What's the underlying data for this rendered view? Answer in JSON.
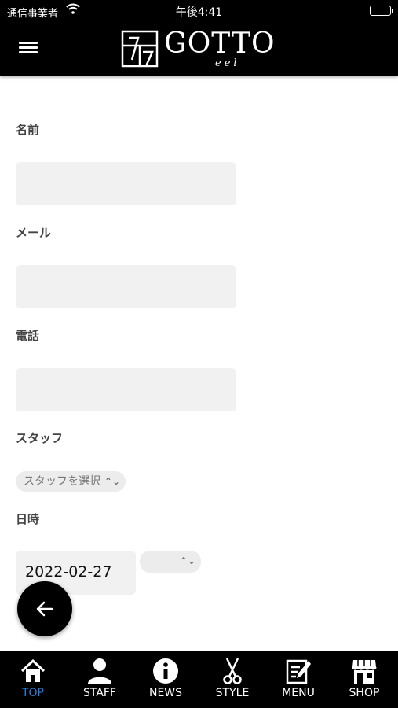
{
  "status_bar": {
    "carrier": "通信事業者",
    "time": "午後4:41"
  },
  "header": {
    "menu_icon": "hamburger-menu-icon",
    "logo_text": "GOTTO",
    "logo_sub": "eel"
  },
  "form": {
    "name_label": "名前",
    "email_label": "メール",
    "phone_label": "電話",
    "staff_label": "スタッフ",
    "staff_select_value": "スタッフを選択",
    "datetime_label": "日時",
    "date_value": "2022-02-27",
    "time_select_value": ""
  },
  "fab": {
    "icon": "arrow-left-icon"
  },
  "tab_bar": {
    "active_color": "#2f7bd9",
    "items": [
      {
        "label": "TOP",
        "icon": "home-icon"
      },
      {
        "label": "STAFF",
        "icon": "person-icon"
      },
      {
        "label": "NEWS",
        "icon": "info-icon"
      },
      {
        "label": "STYLE",
        "icon": "scissors-icon"
      },
      {
        "label": "MENU",
        "icon": "edit-list-icon"
      },
      {
        "label": "SHOP",
        "icon": "storefront-icon"
      }
    ]
  }
}
